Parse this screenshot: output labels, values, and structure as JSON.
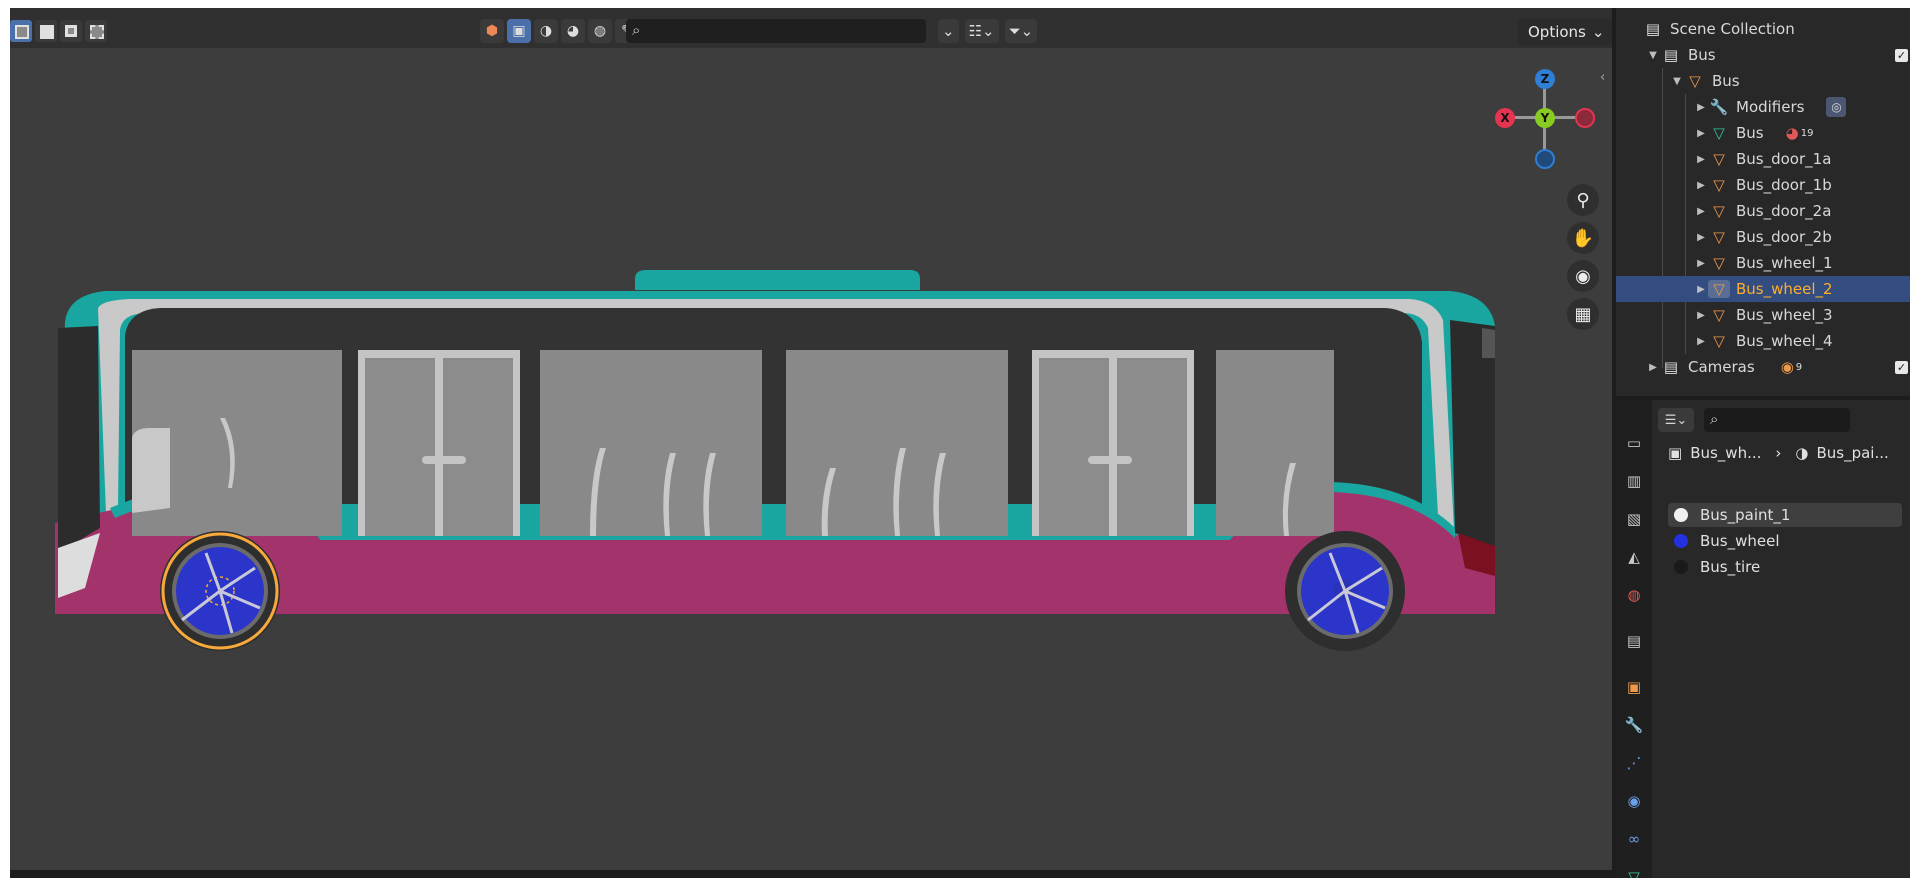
{
  "colors": {
    "viewport_bg": "#3d3d3d",
    "panel_bg": "#282828",
    "selected_row": "#334d80",
    "highlight_text": "#ffaf29",
    "axis_x": "#e53451",
    "axis_y": "#88cc22",
    "axis_z": "#2f7fd6",
    "bus_teal": "#1aa6a0",
    "bus_magenta": "#a3336b",
    "wheel_blue": "#2b35c9",
    "selection_outline": "#f7a93b"
  },
  "viewport": {
    "search": {
      "value": "",
      "placeholder": ""
    },
    "options_label": "Options",
    "gizmo": {
      "z": "Z",
      "y": "Y",
      "x": "X"
    },
    "nav_icons": [
      "zoom-icon",
      "hand-pan-icon",
      "camera-icon",
      "grid-icon"
    ]
  },
  "outliner": {
    "title": "Scene Collection",
    "items": [
      {
        "label": "Bus",
        "icon": "collection-icon",
        "level": 1,
        "expanded": true
      },
      {
        "label": "Bus",
        "icon": "mesh-object-icon",
        "level": 2,
        "expanded": true
      },
      {
        "label": "Modifiers",
        "icon": "wrench-icon",
        "level": 3
      },
      {
        "label": "Bus",
        "icon": "mesh-data-icon",
        "level": 3,
        "badge": "19"
      },
      {
        "label": "Bus_door_1a",
        "icon": "mesh-object-icon",
        "level": 3
      },
      {
        "label": "Bus_door_1b",
        "icon": "mesh-object-icon",
        "level": 3
      },
      {
        "label": "Bus_door_2a",
        "icon": "mesh-object-icon",
        "level": 3
      },
      {
        "label": "Bus_door_2b",
        "icon": "mesh-object-icon",
        "level": 3
      },
      {
        "label": "Bus_wheel_1",
        "icon": "mesh-object-icon",
        "level": 3
      },
      {
        "label": "Bus_wheel_2",
        "icon": "mesh-object-icon",
        "level": 3,
        "selected": true
      },
      {
        "label": "Bus_wheel_3",
        "icon": "mesh-object-icon",
        "level": 3
      },
      {
        "label": "Bus_wheel_4",
        "icon": "mesh-object-icon",
        "level": 3
      },
      {
        "label": "Cameras",
        "icon": "collection-icon",
        "level": 1,
        "badge": "9"
      }
    ]
  },
  "properties": {
    "search": {
      "value": "",
      "placeholder": ""
    },
    "breadcrumb": {
      "object": "Bus_wh...",
      "material": "Bus_pai..."
    },
    "materials": [
      {
        "name": "Bus_paint_1",
        "color": "#f0f0f0",
        "active": true
      },
      {
        "name": "Bus_wheel",
        "color": "#2331e0"
      },
      {
        "name": "Bus_tire",
        "color": "#1a1a1a"
      }
    ]
  }
}
